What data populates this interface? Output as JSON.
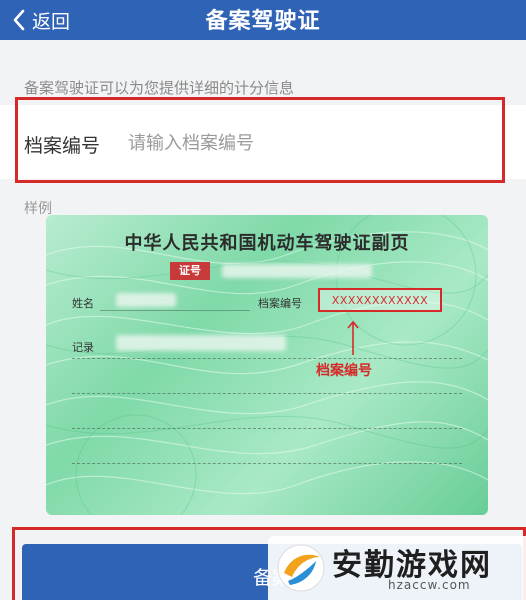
{
  "nav": {
    "back_label": "返回",
    "title": "备案驾驶证"
  },
  "form": {
    "hint": "备案驾驶证可以为您提供详细的计分信息",
    "field_label": "档案编号",
    "field_placeholder": "请输入档案编号",
    "field_value": ""
  },
  "sample": {
    "label": "样例",
    "card_title": "中华人民共和国机动车驾驶证副页",
    "cert_badge": "证号",
    "name_label": "姓名",
    "file_no_label": "档案编号",
    "file_no_value": "XXXXXXXXXXXX",
    "record_label": "记录",
    "annotation": "档案编号"
  },
  "action": {
    "button_label": "备案"
  },
  "watermark": {
    "name": "安勤游戏网",
    "url": "hzaccw.com"
  },
  "colors": {
    "nav_bg": "#2f63b6",
    "highlight": "#d62a2a",
    "card_green": "#7fd9a8"
  }
}
